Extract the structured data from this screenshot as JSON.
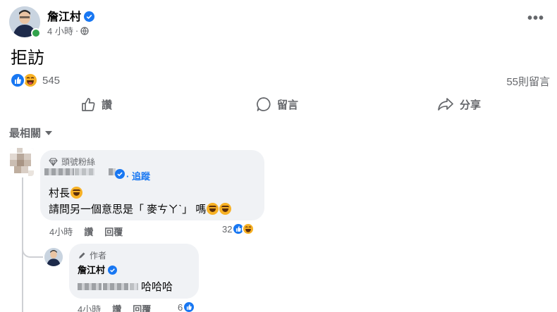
{
  "post": {
    "author": "詹江村",
    "time": "4 小時",
    "text": "拒訪",
    "reaction_count": "545",
    "comment_count": "55則留言",
    "reactions": [
      "like-icon",
      "haha-icon"
    ]
  },
  "actions": {
    "like": "讚",
    "comment": "留言",
    "share": "分享"
  },
  "sort_label": "最相關",
  "comments": [
    {
      "badge": "頭號粉絲",
      "follow": "· 追蹤",
      "line1": "村長",
      "line2": "請問另一個意思是「 麥ㄘㄚˋ」 嗎",
      "time": "4小時",
      "like": "讚",
      "reply": "回覆",
      "reaction_count": "32"
    }
  ],
  "reply": {
    "badge": "作者",
    "author": "詹江村",
    "text": "哈哈哈",
    "time": "4小時",
    "like": "讚",
    "reply": "回覆",
    "reaction_count": "6"
  },
  "colors": {
    "accent": "#1877f2",
    "secondary_text": "#65676b",
    "bubble": "#f0f2f5",
    "online": "#31a24c"
  }
}
